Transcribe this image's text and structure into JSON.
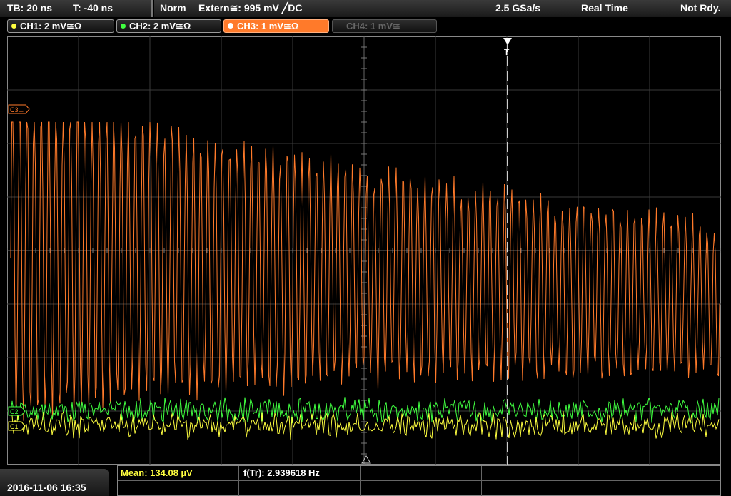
{
  "topbar": {
    "timebase": "TB: 20 ns",
    "trigger_time": "T: -40 ns",
    "trigger_mode": "Norm",
    "trigger_source": "Extern≅: 995 mV ╱DC",
    "sample_rate": "2.5 GSa/s",
    "acq_mode": "Real Time",
    "status": "Not Rdy."
  },
  "channels": [
    {
      "label": "CH1: 2 mV≅Ω",
      "color": "#ffff40",
      "state": "on"
    },
    {
      "label": "CH2: 2 mV≅Ω",
      "color": "#40ff40",
      "state": "on"
    },
    {
      "label": "CH3: 1 mV≅Ω",
      "color": "#ff7a2a",
      "state": "selected"
    },
    {
      "label": "CH4: 1 mV≅",
      "color": "#666666",
      "state": "off"
    }
  ],
  "markers": {
    "c3": "C3⊥",
    "c2": "C2",
    "c1": "C1",
    "trigger": "T"
  },
  "measurements": {
    "mean": "Mean: 134.08 µV",
    "freq": "f(Tr): 2.939618 Hz"
  },
  "footer": {
    "datetime": "2016-11-06 16:35"
  },
  "colors": {
    "ch1": "#ffff40",
    "ch2": "#40ff40",
    "ch3": "#ff7a2a",
    "grid": "#555555"
  }
}
